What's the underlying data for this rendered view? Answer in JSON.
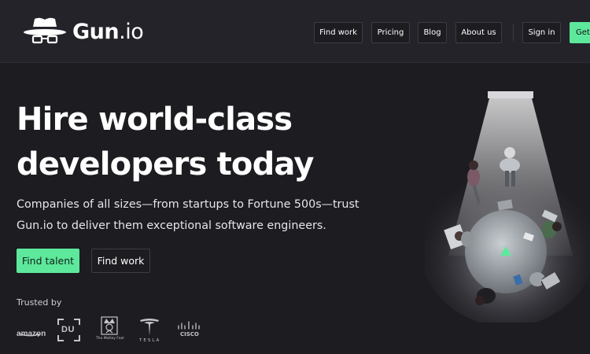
{
  "header": {
    "logo_text": "Gun",
    "logo_suffix": ".io",
    "nav": {
      "find_work": "Find work",
      "pricing": "Pricing",
      "blog": "Blog",
      "about_us": "About us",
      "sign_in": "Sign in",
      "get_started": "Get"
    }
  },
  "hero": {
    "title_line1": "Hire world-class",
    "title_line2": "developers today",
    "subtitle_line1": "Companies of all sizes—from startups to Fortune 500s—trust",
    "subtitle_line2": "Gun.io to deliver them exceptional software engineers.",
    "primary_cta": "Find talent",
    "secondary_cta": "Find work"
  },
  "trusted": {
    "label": "Trusted by",
    "logos": {
      "amazon": "amazon",
      "du": "DU",
      "motley_fool": "The Motley Fool",
      "tesla": "TESLA",
      "cisco": "CISCO"
    }
  },
  "colors": {
    "background": "#1c1c21",
    "header_bg": "#232329",
    "accent": "#5ee89b",
    "text": "#ffffff"
  }
}
